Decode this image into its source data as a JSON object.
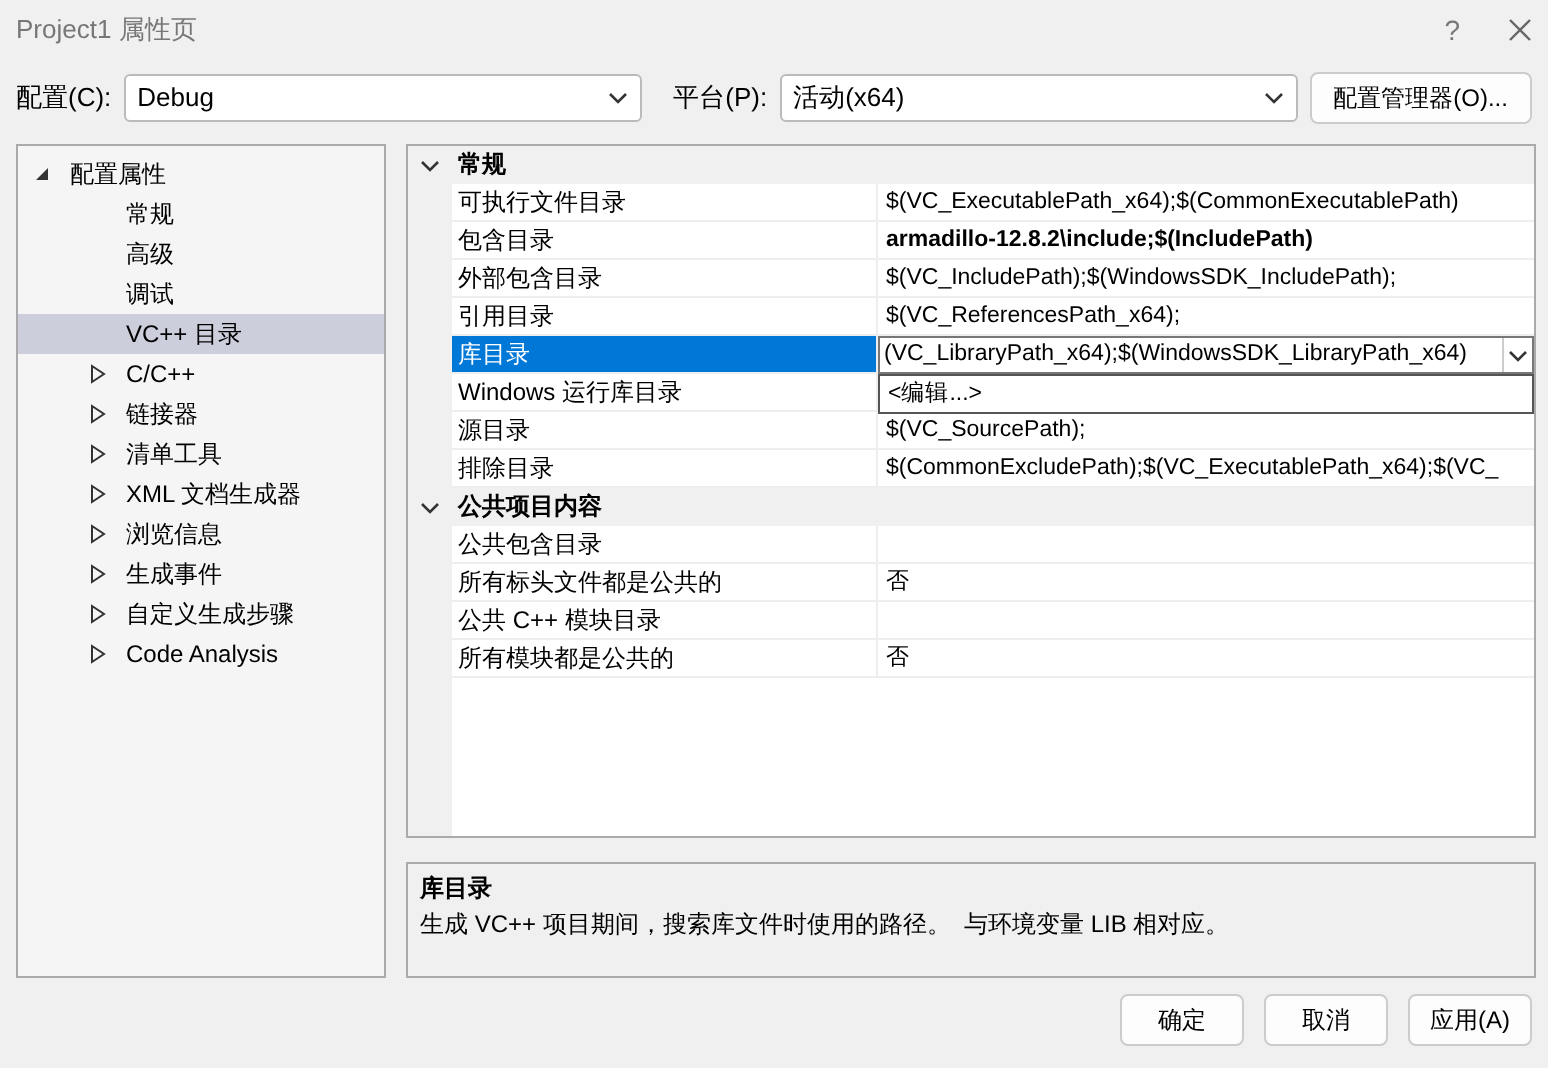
{
  "window": {
    "title": "Project1 属性页",
    "help": "?"
  },
  "toolbar": {
    "configuration": {
      "label": "配置(C):",
      "value": "Debug"
    },
    "platform": {
      "label": "平台(P):",
      "value": "活动(x64)"
    },
    "manager_button": "配置管理器(O)..."
  },
  "sidebar": {
    "items": [
      {
        "label": "配置属性",
        "expanded": true,
        "selected": false,
        "children": [
          {
            "label": "常规",
            "selected": false
          },
          {
            "label": "高级",
            "selected": false
          },
          {
            "label": "调试",
            "selected": false
          },
          {
            "label": "VC++ 目录",
            "selected": true
          },
          {
            "label": "C/C++",
            "expanded": false,
            "selected": false
          },
          {
            "label": "链接器",
            "expanded": false,
            "selected": false
          },
          {
            "label": "清单工具",
            "expanded": false,
            "selected": false
          },
          {
            "label": "XML 文档生成器",
            "expanded": false,
            "selected": false
          },
          {
            "label": "浏览信息",
            "expanded": false,
            "selected": false
          },
          {
            "label": "生成事件",
            "expanded": false,
            "selected": false
          },
          {
            "label": "自定义生成步骤",
            "expanded": false,
            "selected": false
          },
          {
            "label": "Code Analysis",
            "expanded": false,
            "selected": false
          }
        ]
      }
    ]
  },
  "property_grid": {
    "categories": [
      {
        "name": "常规",
        "expanded": true,
        "rows": [
          {
            "name": "可执行文件目录",
            "value": "$(VC_ExecutablePath_x64);$(CommonExecutablePath)",
            "bold": false,
            "selected": false
          },
          {
            "name": "包含目录",
            "value": "armadillo-12.8.2\\include;$(IncludePath)",
            "bold": true,
            "selected": false
          },
          {
            "name": "外部包含目录",
            "value": "$(VC_IncludePath);$(WindowsSDK_IncludePath);",
            "bold": false,
            "selected": false
          },
          {
            "name": "引用目录",
            "value": "$(VC_ReferencesPath_x64);",
            "bold": false,
            "selected": false
          },
          {
            "name": "库目录",
            "value": "(VC_LibraryPath_x64);$(WindowsSDK_LibraryPath_x64)",
            "bold": false,
            "selected": true,
            "dropdown_items": [
              "<编辑...>"
            ]
          },
          {
            "name": "Windows 运行库目录",
            "selected": false
          },
          {
            "name": "源目录",
            "value": "$(VC_SourcePath);",
            "bold": false,
            "selected": false
          },
          {
            "name": "排除目录",
            "value": "$(CommonExcludePath);$(VC_ExecutablePath_x64);$(VC_",
            "bold": false,
            "selected": false
          }
        ]
      },
      {
        "name": "公共项目内容",
        "expanded": true,
        "rows": [
          {
            "name": "公共包含目录",
            "selected": false
          },
          {
            "name": "所有标头文件都是公共的",
            "value": "否",
            "bold": false,
            "selected": false
          },
          {
            "name": "公共 C++ 模块目录",
            "selected": false
          },
          {
            "name": "所有模块都是公共的",
            "value": "否",
            "bold": false,
            "selected": false
          }
        ]
      }
    ]
  },
  "description": {
    "title": "库目录",
    "text": "生成 VC++ 项目期间，搜索库文件时使用的路径。  与环境变量 LIB 相对应。"
  },
  "buttons": [
    "确定",
    "取消",
    "应用(A)"
  ]
}
